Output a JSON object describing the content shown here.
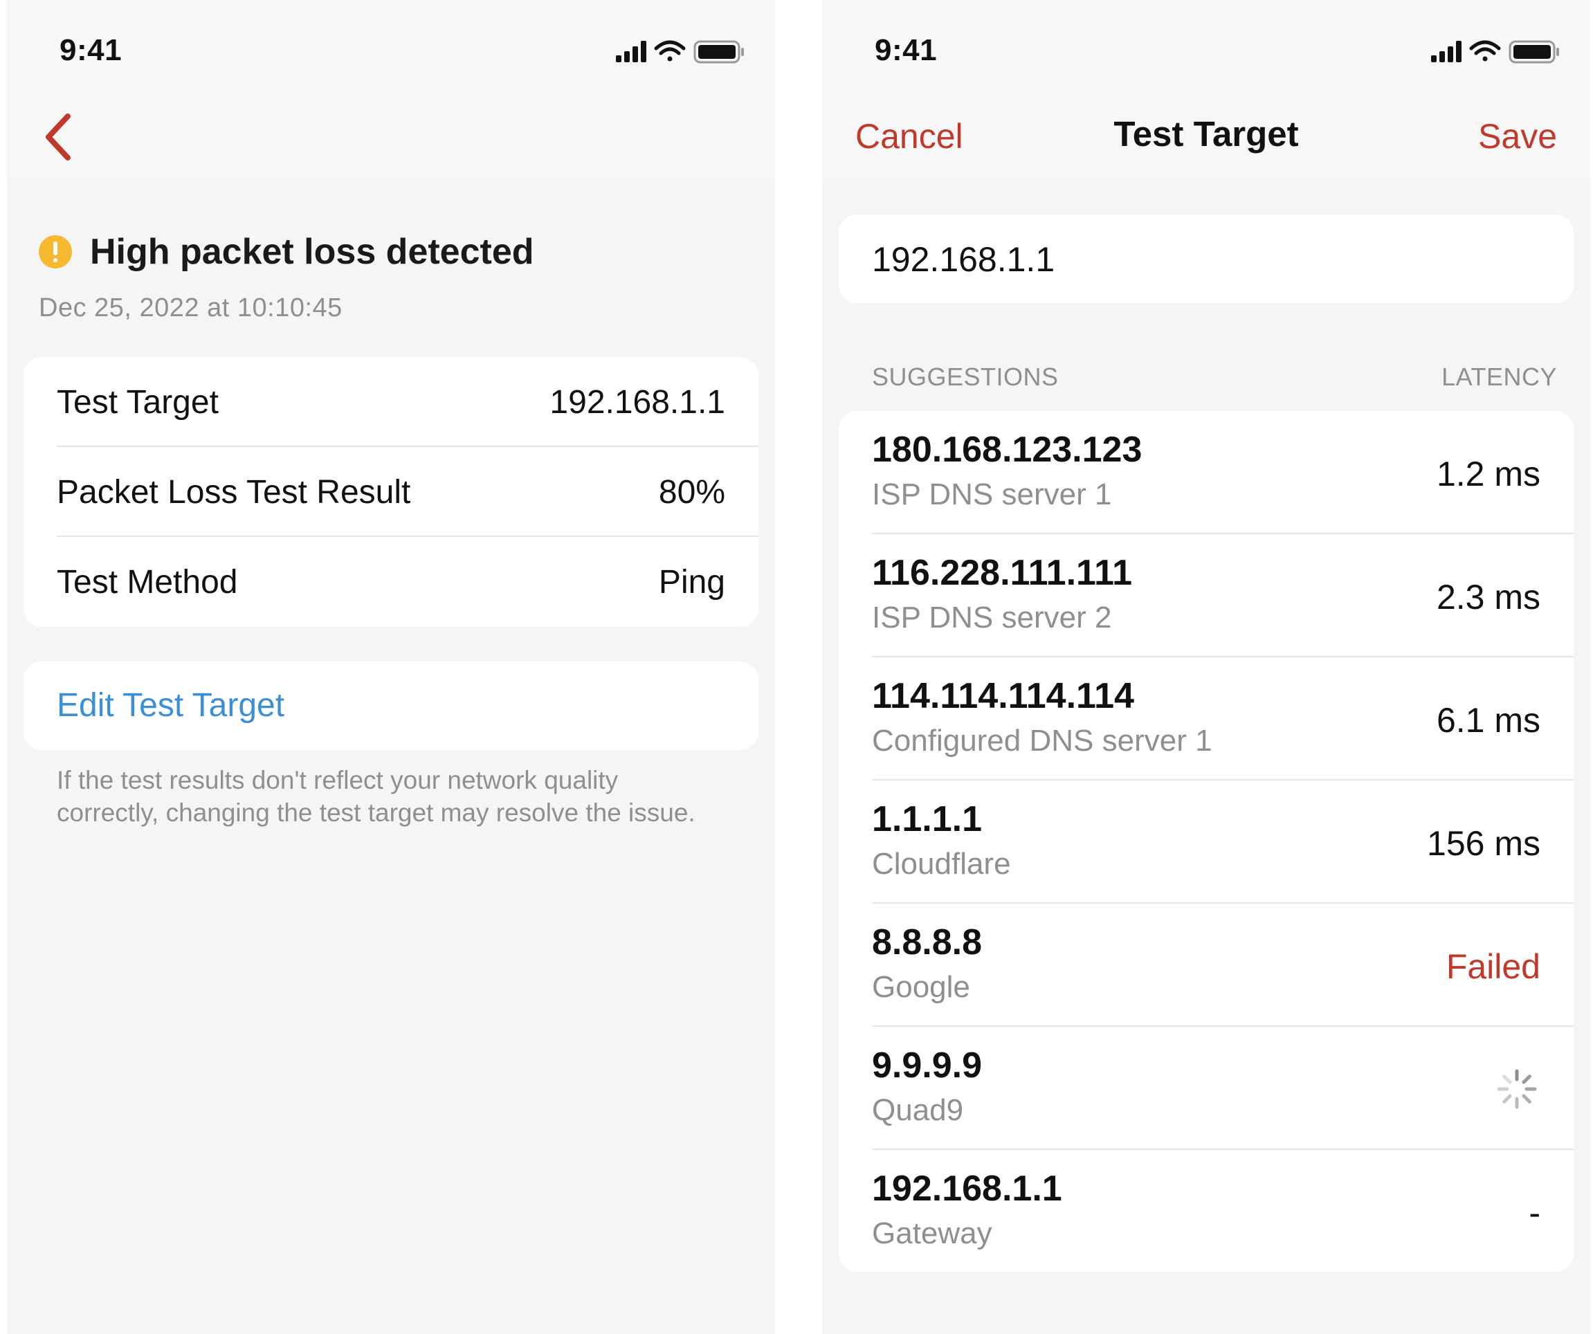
{
  "status_bar": {
    "time": "9:41"
  },
  "left_screen": {
    "alert": {
      "title": "High packet loss detected",
      "date": "Dec 25, 2022 at 10:10:45",
      "icon": "exclamation-circle-icon",
      "icon_color": "#f5b82e"
    },
    "details": [
      {
        "label": "Test Target",
        "value": "192.168.1.1"
      },
      {
        "label": "Packet Loss Test Result",
        "value": "80%"
      },
      {
        "label": "Test Method",
        "value": "Ping"
      }
    ],
    "edit_button_label": "Edit Test Target",
    "footnote": "If the test results don't reflect your network quality correctly, changing the test target may resolve the issue."
  },
  "right_screen": {
    "nav": {
      "cancel_label": "Cancel",
      "title": "Test Target",
      "save_label": "Save"
    },
    "input_value": "192.168.1.1",
    "section_header": {
      "left": "SUGGESTIONS",
      "right": "LATENCY"
    },
    "suggestions": [
      {
        "ip": "180.168.123.123",
        "desc": "ISP DNS server 1",
        "latency": "1.2 ms"
      },
      {
        "ip": "116.228.111.111",
        "desc": "ISP DNS server 2",
        "latency": "2.3 ms"
      },
      {
        "ip": "114.114.114.114",
        "desc": "Configured DNS server 1",
        "latency": "6.1 ms"
      },
      {
        "ip": "1.1.1.1",
        "desc": "Cloudflare",
        "latency": "156 ms"
      },
      {
        "ip": "8.8.8.8",
        "desc": "Google",
        "latency": "Failed"
      },
      {
        "ip": "9.9.9.9",
        "desc": "Quad9",
        "latency": ""
      },
      {
        "ip": "192.168.1.1",
        "desc": "Gateway",
        "latency": "-"
      }
    ]
  },
  "colors": {
    "accent": "#c0392b",
    "link": "#3b8fd6",
    "secondary_text": "#8e8e93",
    "background": "#f5f5f5",
    "card": "#ffffff"
  }
}
